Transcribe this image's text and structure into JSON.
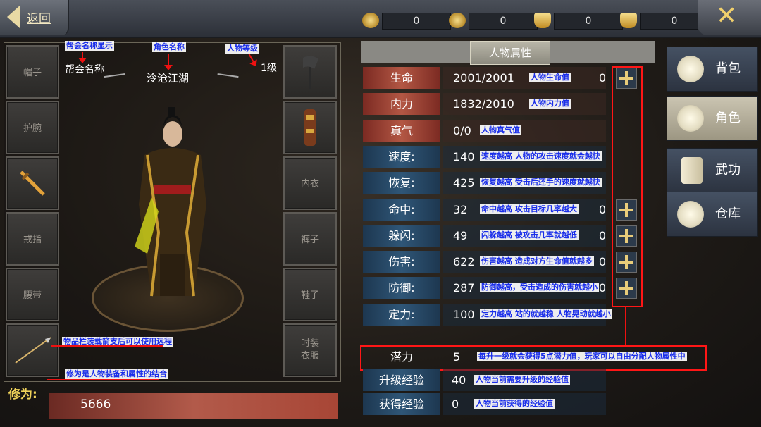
{
  "header": {
    "back_label": "返回",
    "currencies": [
      {
        "icon": "copper-coin-icon",
        "value": "0"
      },
      {
        "icon": "silver-coin-icon",
        "value": "0"
      },
      {
        "icon": "gold-ingot-icon",
        "value": "0"
      },
      {
        "icon": "gem-ingot-icon",
        "value": "0"
      }
    ],
    "close_icon": "close-x-icon"
  },
  "equipment": {
    "left_slots": [
      "帽子",
      "护腕",
      "",
      "戒指",
      "腰带",
      ""
    ],
    "right_slots": [
      "",
      "",
      "内衣",
      "裤子",
      "鞋子",
      "时装\n衣服"
    ],
    "guild_name": "帮会名称",
    "role_name": "泠沧江湖",
    "level": "1级"
  },
  "annotations": {
    "guild": "帮会名称显示",
    "role": "角色名称",
    "level": "人物等级",
    "ranged": "物品栏装载箭支后可以使用远程",
    "xiuwei": "修为是人物装备和属性的结合"
  },
  "xiuwei": {
    "label": "修为:",
    "value": "5666"
  },
  "attributes": {
    "title": "人物属性",
    "rows": [
      {
        "name": "生命",
        "value": "2001/2001",
        "note": "人物生命值",
        "points": "0",
        "color": "red",
        "plus": true
      },
      {
        "name": "内力",
        "value": "1832/2010",
        "note": "人物内力值",
        "points": "",
        "color": "red",
        "plus": false
      },
      {
        "name": "真气",
        "value": "0/0",
        "note": "人物真气值",
        "points": "",
        "color": "red",
        "plus": false
      },
      {
        "name": "速度:",
        "value": "140",
        "note": "速度越高 人物的攻击速度就会越快",
        "points": "",
        "color": "blue",
        "plus": false
      },
      {
        "name": "恢复:",
        "value": "425",
        "note": "恢复越高 受击后还手的速度就越快",
        "points": "",
        "color": "blue",
        "plus": false
      },
      {
        "name": "命中:",
        "value": "32",
        "note": "命中越高 攻击目标几率越大",
        "points": "0",
        "color": "blue",
        "plus": true
      },
      {
        "name": "躲闪:",
        "value": "49",
        "note": "闪躲越高 被攻击几率就越低",
        "points": "0",
        "color": "blue",
        "plus": true
      },
      {
        "name": "伤害:",
        "value": "622",
        "note": "伤害越高 造成对方生命值就越多",
        "points": "0",
        "color": "blue",
        "plus": true
      },
      {
        "name": "防御:",
        "value": "287",
        "note": "防御越高，受击造成的伤害就越小",
        "points": "0",
        "color": "blue",
        "plus": true
      },
      {
        "name": "定力:",
        "value": "100",
        "note": "定力越高 站的就越稳 人物晃动就越小",
        "points": "",
        "color": "blue",
        "plus": false
      }
    ],
    "potential": {
      "name": "潜力",
      "value": "5",
      "note": "每升一级就会获得5点潜力值，玩家可以自由分配人物属性中"
    },
    "upgrade_exp": {
      "name": "升级经验",
      "value": "40",
      "note": "人物当前需要升级的经验值"
    },
    "gained_exp": {
      "name": "获得经验",
      "value": "0",
      "note": "人物当前获得的经验值"
    }
  },
  "tabs": [
    {
      "label": "背包",
      "icon": "bag-icon"
    },
    {
      "label": "角色",
      "icon": "character-icon"
    },
    {
      "label": "武功",
      "icon": "book-icon"
    },
    {
      "label": "仓库",
      "icon": "storage-bag-icon"
    }
  ],
  "active_tab": "角色"
}
